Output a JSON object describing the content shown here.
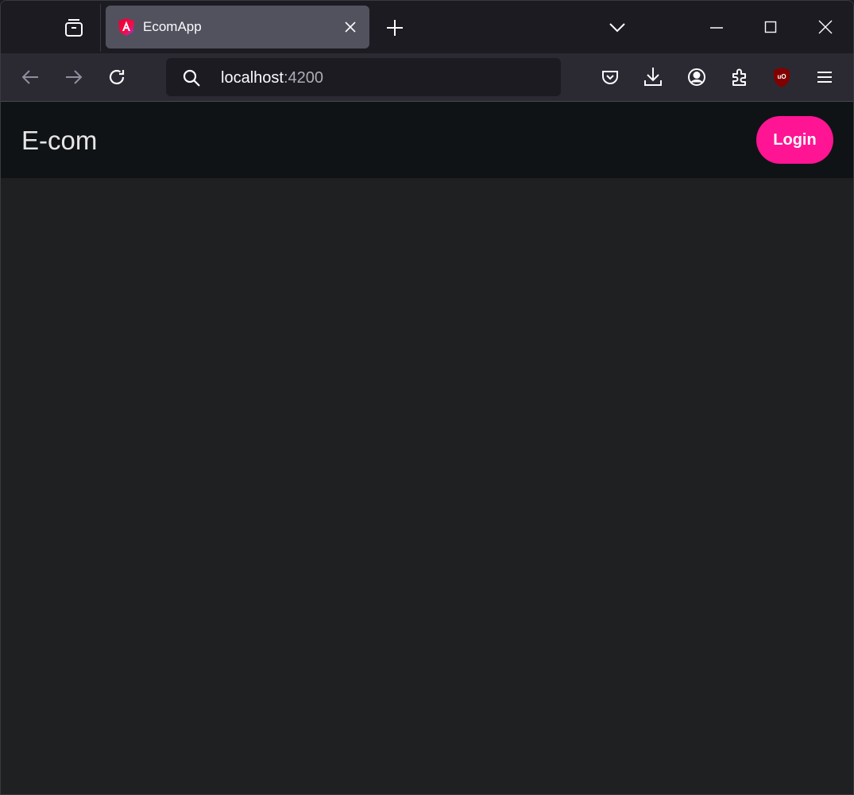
{
  "browser": {
    "tab": {
      "title": "EcomApp",
      "favicon": "angular-logo-icon"
    },
    "url": {
      "host": "localhost",
      "port": ":4200"
    },
    "icons": {
      "tab_overview": "tab-overview-icon",
      "new_tab": "plus-icon",
      "list_all_tabs": "chevron-down-icon",
      "minimize": "minimize-icon",
      "maximize": "maximize-icon",
      "close_window": "close-icon",
      "back": "back-arrow-icon",
      "forward": "forward-arrow-icon",
      "reload": "reload-icon",
      "search": "search-icon",
      "pocket": "pocket-icon",
      "downloads": "download-icon",
      "account": "account-icon",
      "extensions": "puzzle-icon",
      "ublock": "ublock-origin-icon",
      "menu": "hamburger-menu-icon"
    }
  },
  "app": {
    "brand": "E-com",
    "login_label": "Login",
    "accent_color": "#ff1493"
  }
}
